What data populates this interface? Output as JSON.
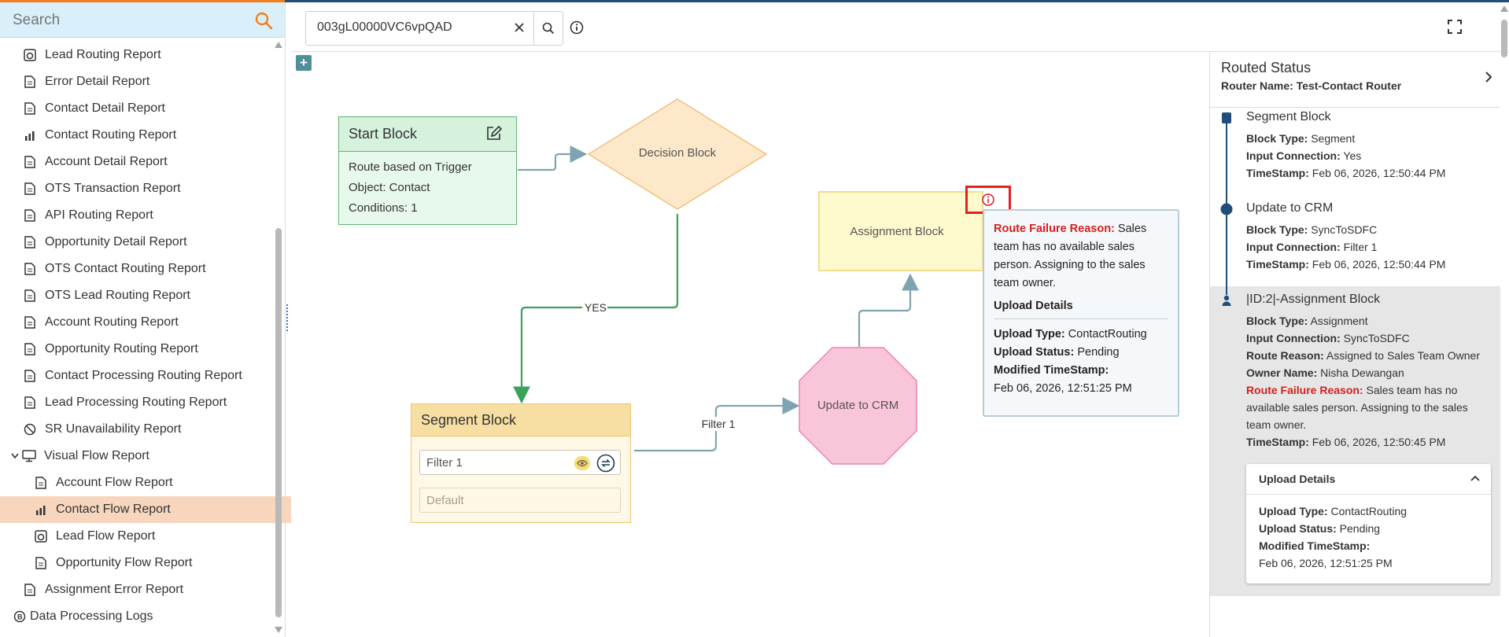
{
  "sidebar": {
    "search_placeholder": "Search",
    "items": [
      {
        "label": "Lead Routing Report",
        "icon": "report-gauge-icon"
      },
      {
        "label": "Error Detail Report",
        "icon": "report-doc-icon"
      },
      {
        "label": "Contact Detail Report",
        "icon": "report-doc-icon"
      },
      {
        "label": "Contact Routing Report",
        "icon": "report-chart-icon"
      },
      {
        "label": "Account Detail Report",
        "icon": "report-doc-icon"
      },
      {
        "label": "OTS Transaction Report",
        "icon": "report-doc-icon"
      },
      {
        "label": "API Routing Report",
        "icon": "report-doc-icon"
      },
      {
        "label": "Opportunity Detail Report",
        "icon": "report-doc-icon"
      },
      {
        "label": "OTS Contact Routing Report",
        "icon": "report-doc-icon"
      },
      {
        "label": "OTS Lead Routing Report",
        "icon": "report-doc-icon"
      },
      {
        "label": "Account Routing Report",
        "icon": "report-doc-icon"
      },
      {
        "label": "Opportunity Routing Report",
        "icon": "report-doc-icon"
      },
      {
        "label": "Contact Processing Routing Report",
        "icon": "report-doc-icon"
      },
      {
        "label": "Lead Processing Routing Report",
        "icon": "report-doc-icon"
      },
      {
        "label": "SR Unavailability Report",
        "icon": "report-doc-icon"
      },
      {
        "label": "Visual Flow Report",
        "icon": "monitor-icon"
      },
      {
        "label": "Account Flow Report",
        "icon": "report-doc-icon"
      },
      {
        "label": "Contact Flow Report",
        "icon": "report-chart-icon"
      },
      {
        "label": "Lead Flow Report",
        "icon": "report-gauge-icon"
      },
      {
        "label": "Opportunity Flow Report",
        "icon": "report-doc-icon"
      },
      {
        "label": "Assignment Error Report",
        "icon": "report-doc-icon"
      },
      {
        "label": "Data Processing Logs",
        "icon": "logs-icon"
      }
    ]
  },
  "toolbar": {
    "record_id": "003gL00000VC6vpQAD"
  },
  "canvas": {
    "start_block": {
      "title": "Start Block",
      "line1": "Route based on Trigger",
      "line2": "Object: Contact",
      "line3": "Conditions: 1"
    },
    "decision_block": "Decision Block",
    "yes_label": "YES",
    "segment_block": {
      "title": "Segment Block",
      "filter": "Filter 1",
      "default": "Default"
    },
    "filter_edge_label": "Filter 1",
    "update_crm": "Update to CRM",
    "assignment_block": "Assignment Block",
    "tooltip": {
      "failure_label": "Route Failure Reason:",
      "failure_text": "Sales team has no available sales person. Assigning to the sales team owner.",
      "upload_heading": "Upload Details",
      "upload_type_label": "Upload Type:",
      "upload_type": "ContactRouting",
      "upload_status_label": "Upload Status:",
      "upload_status": "Pending",
      "modified_label": "Modified TimeStamp:",
      "modified": "Feb 06, 2026, 12:51:25 PM"
    }
  },
  "panel": {
    "title": "Routed Status",
    "router_name": "Router Name: Test-Contact Router",
    "steps": [
      {
        "name": "Segment Block",
        "block_type_label": "Block Type:",
        "block_type": "Segment",
        "input_label": "Input Connection:",
        "input": "Yes",
        "ts_label": "TimeStamp:",
        "ts": "Feb 06, 2026, 12:50:44 PM"
      },
      {
        "name": "Update to CRM",
        "block_type_label": "Block Type:",
        "block_type": "SyncToSDFC",
        "input_label": "Input Connection:",
        "input": "Filter 1",
        "ts_label": "TimeStamp:",
        "ts": "Feb 06, 2026, 12:50:44 PM"
      },
      {
        "name": "|ID:2|-Assignment Block",
        "block_type_label": "Block Type:",
        "block_type": "Assignment",
        "input_label": "Input Connection:",
        "input": "SyncToSDFC",
        "reason_label": "Route Reason:",
        "reason": "Assigned to Sales Team Owner",
        "owner_label": "Owner Name:",
        "owner": "Nisha Dewangan",
        "failure_label": "Route Failure Reason:",
        "failure_line1": "Sales team has no",
        "failure_line2": "available sales person. Assigning to the sales",
        "failure_line3": "team owner.",
        "ts_label": "TimeStamp:",
        "ts": "Feb 06, 2026, 12:50:45 PM"
      }
    ],
    "upload": {
      "title": "Upload Details",
      "type_label": "Upload Type:",
      "type": "ContactRouting",
      "status_label": "Upload Status:",
      "status": "Pending",
      "modified_label": "Modified TimeStamp:",
      "modified": "Feb 06, 2026, 12:51:25 PM"
    }
  },
  "colors": {
    "accent_orange": "#f47c20",
    "nav_blue": "#1f4e79",
    "failure_red": "#d51f1f",
    "start_green": "#5cb36f",
    "edge_green": "#3aa25c",
    "edge_grey": "#7fa4b1"
  }
}
